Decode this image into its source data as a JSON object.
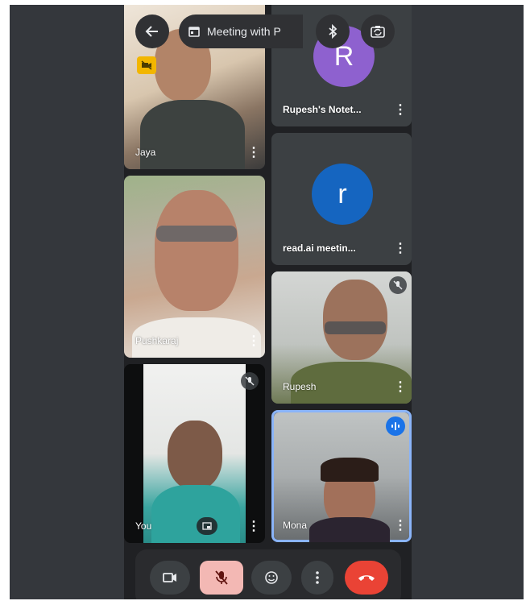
{
  "top_bar": {
    "meeting_title": "Meeting with P",
    "back_icon": "arrow-left-icon",
    "calendar_icon": "calendar-icon",
    "bluetooth_icon": "bluetooth-icon",
    "switch_camera_icon": "switch-camera-icon"
  },
  "participants": [
    {
      "name": "Jaya",
      "status": "camera-off-badge"
    },
    {
      "name": "Rupesh's Notet...",
      "avatar_letter": "R",
      "avatar_color": "#8e61cf"
    },
    {
      "name": "read.ai meetin...",
      "avatar_letter": "r",
      "avatar_color": "#1565c0"
    },
    {
      "name": "Pushkaraj"
    },
    {
      "name": "Rupesh",
      "status": "muted"
    },
    {
      "name": "You",
      "status": "muted"
    },
    {
      "name": "Mona",
      "status": "speaking"
    }
  ],
  "controls": {
    "camera": "camera-icon",
    "mic": "mic-off-icon",
    "reactions": "emoji-icon",
    "more": "more-vertical-icon",
    "end_call": "end-call-icon"
  },
  "colors": {
    "background": "#202124",
    "speaking_accent": "#8ab4f8",
    "end_call": "#ea4335",
    "mic_off_bg": "#f3b8b4",
    "camera_off_badge": "#f2b600"
  }
}
